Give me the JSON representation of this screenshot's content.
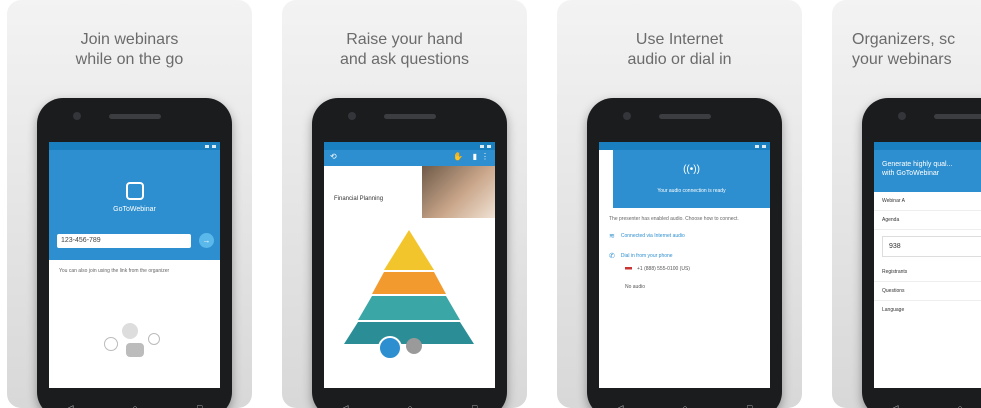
{
  "cards": [
    {
      "caption": "Join webinars\nwhile on the go",
      "screen": {
        "logo_text": "GoToWebinar",
        "webinar_id_value": "123-456-789",
        "hint": "You can also join using the link from the organizer"
      }
    },
    {
      "caption": "Raise your hand\nand ask questions",
      "screen": {
        "slide_title": "Financial Planning"
      }
    },
    {
      "caption": "Use Internet\naudio or dial in",
      "screen": {
        "header_text": "Your audio connection is ready",
        "body_text": "The presenter has enabled audio. Choose how to connect.",
        "option_internet": "Connected via Internet audio",
        "option_dial": "Dial in from your phone",
        "phone_number": "+1 (888) 555-0100 (US)",
        "option_none": "No audio"
      }
    },
    {
      "caption": "Organizers, sc\nyour webinars",
      "screen": {
        "header_text": "Generate highly qual...\nwith GoToWebinar",
        "stat_value": "938",
        "rows": [
          "Webinar A",
          "Agenda",
          "Registrants",
          "Questions",
          "Language"
        ]
      }
    }
  ],
  "nav": {
    "back": "◁",
    "home": "○",
    "recent": "□"
  },
  "colors": {
    "brand_blue": "#2d8fcf",
    "teal": "#3aa6a6",
    "orange": "#f29a2e",
    "yellow": "#f3c52d"
  }
}
